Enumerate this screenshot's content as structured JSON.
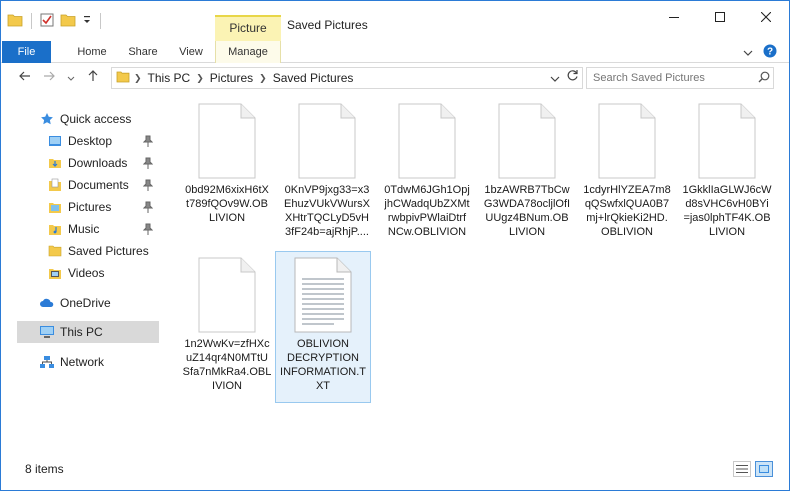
{
  "window": {
    "title": "Saved Pictures",
    "context_tab": "Picture Tools"
  },
  "ribbon": {
    "tabs": [
      {
        "label": "File"
      },
      {
        "label": "Home"
      },
      {
        "label": "Share"
      },
      {
        "label": "View"
      },
      {
        "label": "Manage"
      }
    ]
  },
  "address": {
    "crumbs": [
      "This PC",
      "Pictures",
      "Saved Pictures"
    ],
    "search_placeholder": "Search Saved Pictures"
  },
  "sidebar": {
    "items": [
      {
        "label": "Quick access",
        "icon": "star-icon",
        "pinned": false
      },
      {
        "label": "Desktop",
        "icon": "desktop-folder-icon",
        "pinned": true
      },
      {
        "label": "Downloads",
        "icon": "downloads-folder-icon",
        "pinned": true
      },
      {
        "label": "Documents",
        "icon": "documents-folder-icon",
        "pinned": true
      },
      {
        "label": "Pictures",
        "icon": "pictures-folder-icon",
        "pinned": true
      },
      {
        "label": "Music",
        "icon": "music-folder-icon",
        "pinned": true
      },
      {
        "label": "Saved Pictures",
        "icon": "folder-icon",
        "pinned": false
      },
      {
        "label": "Videos",
        "icon": "videos-folder-icon",
        "pinned": false
      },
      {
        "label": "OneDrive",
        "icon": "onedrive-cloud-icon",
        "pinned": false
      },
      {
        "label": "This PC",
        "icon": "computer-icon",
        "pinned": false
      },
      {
        "label": "Network",
        "icon": "network-icon",
        "pinned": false
      }
    ]
  },
  "files": [
    {
      "name": "0bd92M6xixH6tXt789fQOv9W.OBLIVION",
      "lines": [
        "0bd92M6xixH6tX",
        "t789fQOv9W.OB",
        "LIVION"
      ]
    },
    {
      "name": "0KnVP9jxg33=x3EhuzVUkVWursXXHtrTQCLyD5vH3fF24b=ajRhjP....",
      "lines": [
        "0KnVP9jxg33=x3",
        "EhuzVUkVWursX",
        "XHtrTQCLyD5vH",
        "3fF24b=ajRhjP...."
      ]
    },
    {
      "name": "0TdwM6JGh1OpjjhCWadqUbZXMtrwbpivPWlaiDtrfNCw.OBLIVION",
      "lines": [
        "0TdwM6JGh1Opj",
        "jhCWadqUbZXMt",
        "rwbpivPWlaiDtrf",
        "NCw.OBLIVION"
      ]
    },
    {
      "name": "1bzAWRB7TbCwG3WDA78ocljlOfIUUgz4BNum.OBLIVION",
      "lines": [
        "1bzAWRB7TbCw",
        "G3WDA78ocljlOfI",
        "UUgz4BNum.OB",
        "LIVION"
      ]
    },
    {
      "name": "1cdyrHlYZEA7m8qQSwfxlQUA0B7mj+lrQkieKi2HD.OBLIVION",
      "lines": [
        "1cdyrHlYZEA7m8",
        "qQSwfxlQUA0B7",
        "mj+lrQkieKi2HD.",
        "OBLIVION"
      ]
    },
    {
      "name": "1GkklIaGLWJ6cWd8sVHC6vH0BYi=jas0lphTF4K.OBLIVION",
      "lines": [
        "1GkklIaGLWJ6cW",
        "d8sVHC6vH0BYi",
        "=jas0lphTF4K.OB",
        "LIVION"
      ]
    },
    {
      "name": "1n2WwKv=zfHXcuZ14qr4N0MTtUSfa7nMkRa4.OBLIVION",
      "lines": [
        "1n2WwKv=zfHXc",
        "uZ14qr4N0MTtU",
        "Sfa7nMkRa4.OBL",
        "IVION"
      ]
    },
    {
      "name": "OBLIVION DECRYPTION INFORMATION.TXT",
      "lines": [
        "OBLIVION",
        "DECRYPTION",
        "INFORMATION.T",
        "XT"
      ]
    }
  ],
  "status": {
    "items_text": "8 items"
  }
}
